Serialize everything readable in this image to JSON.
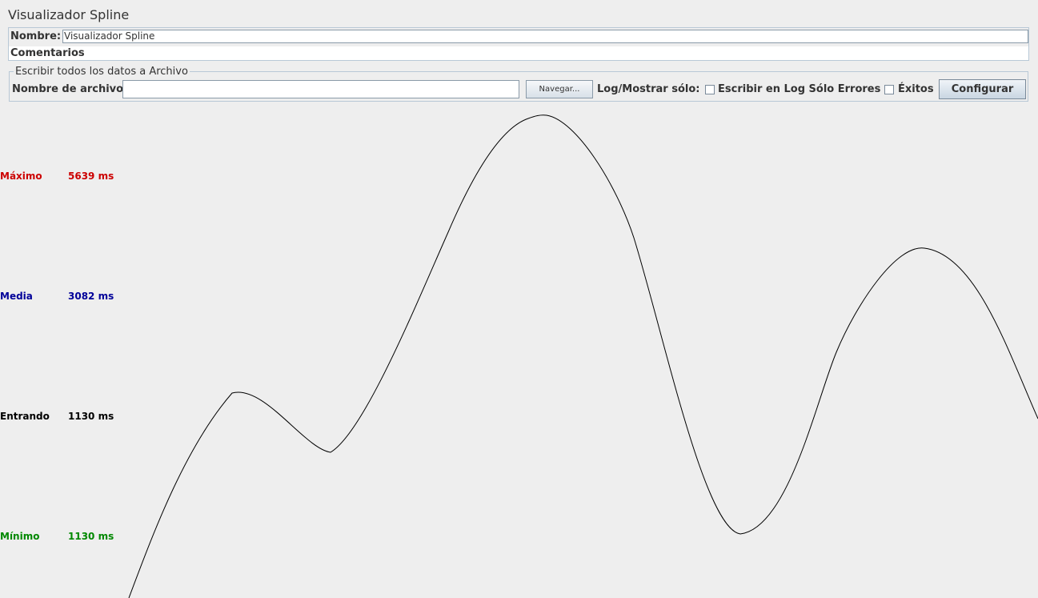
{
  "window": {
    "title": "Visualizador Spline"
  },
  "name_panel": {
    "name_label": "Nombre:",
    "name_value": "Visualizador Spline",
    "comments_label": "Comentarios"
  },
  "file_group": {
    "legend": "Escribir todos los datos a Archivo",
    "filename_label": "Nombre de archivo",
    "filename_value": "",
    "browse_label": "Navegar...",
    "log_label": "Log/Mostrar sólo:",
    "errors_checkbox_label": "Escribir en Log Sólo Errores",
    "errors_checked": false,
    "success_checkbox_label": "Éxitos",
    "success_checked": false,
    "configure_label": "Configurar"
  },
  "stats": {
    "max_label": "Máximo",
    "max_value": "5639 ms",
    "avg_label": "Media",
    "avg_value": "3082 ms",
    "incoming_label": "Entrando",
    "incoming_value": "1130 ms",
    "min_label": "Mínimo",
    "min_value": "1130 ms"
  },
  "colors": {
    "max": "#cc0000",
    "avg": "#000099",
    "incoming": "#000000",
    "min": "#008800",
    "curve": "#000000"
  }
}
